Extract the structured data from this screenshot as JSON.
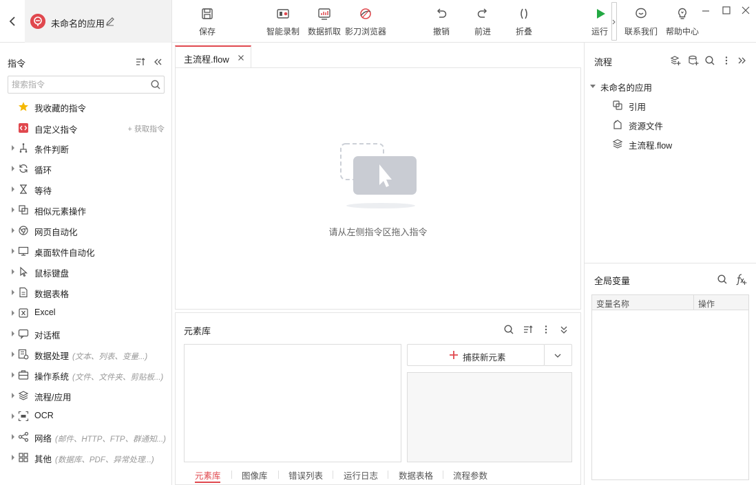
{
  "app": {
    "name": "未命名的应用"
  },
  "toolbar": {
    "save": "保存",
    "record": "智能录制",
    "scrape": "数据抓取",
    "browser": "影刀浏览器",
    "undo": "撤销",
    "redo": "前进",
    "fold": "折叠",
    "run": "运行",
    "contact": "联系我们",
    "help": "帮助中心"
  },
  "colors": {
    "accent": "#e0484e",
    "run_green": "#23a943",
    "icon_gray": "#555555"
  },
  "left_panel": {
    "title": "指令",
    "search_placeholder": "搜索指令",
    "favorites": "我收藏的指令",
    "custom": "自定义指令",
    "get_commands": "+ 获取指令",
    "categories": [
      {
        "label": "条件判断",
        "hint": "",
        "icon": "branch-icon"
      },
      {
        "label": "循环",
        "hint": "",
        "icon": "loop-icon"
      },
      {
        "label": "等待",
        "hint": "",
        "icon": "hourglass-icon"
      },
      {
        "label": "相似元素操作",
        "hint": "",
        "icon": "similar-elements-icon"
      },
      {
        "label": "网页自动化",
        "hint": "",
        "icon": "browser-icon"
      },
      {
        "label": "桌面软件自动化",
        "hint": "",
        "icon": "desktop-icon"
      },
      {
        "label": "鼠标键盘",
        "hint": "",
        "icon": "cursor-icon"
      },
      {
        "label": "数据表格",
        "hint": "",
        "icon": "sheet-icon"
      },
      {
        "label": "Excel",
        "hint": "",
        "icon": "excel-icon"
      },
      {
        "label": "对话框",
        "hint": "",
        "icon": "dialog-icon"
      },
      {
        "label": "数据处理",
        "hint": "(文本、列表、变量...)",
        "icon": "data-process-icon"
      },
      {
        "label": "操作系统",
        "hint": "(文件、文件夹、剪贴板...)",
        "icon": "os-icon"
      },
      {
        "label": "流程/应用",
        "hint": "",
        "icon": "layers-icon"
      },
      {
        "label": "OCR",
        "hint": "",
        "icon": "ocr-icon"
      },
      {
        "label": "网络",
        "hint": "(邮件、HTTP、FTP、群通知...)",
        "icon": "network-icon"
      },
      {
        "label": "其他",
        "hint": "(数据库、PDF、异常处理...)",
        "icon": "grid-icon"
      }
    ]
  },
  "editor": {
    "tab": "主流程.flow",
    "empty_hint": "请从左侧指令区拖入指令"
  },
  "element_library": {
    "title": "元素库",
    "capture": "捕获新元素",
    "tabs": [
      "元素库",
      "图像库",
      "错误列表",
      "运行日志",
      "数据表格",
      "流程参数"
    ],
    "active_tab": "元素库"
  },
  "right_panel": {
    "title": "流程",
    "tree": {
      "root": "未命名的应用",
      "children": [
        "引用",
        "资源文件",
        "主流程.flow"
      ]
    },
    "variables": {
      "title": "全局变量",
      "columns": [
        "变量名称",
        "操作"
      ]
    }
  }
}
